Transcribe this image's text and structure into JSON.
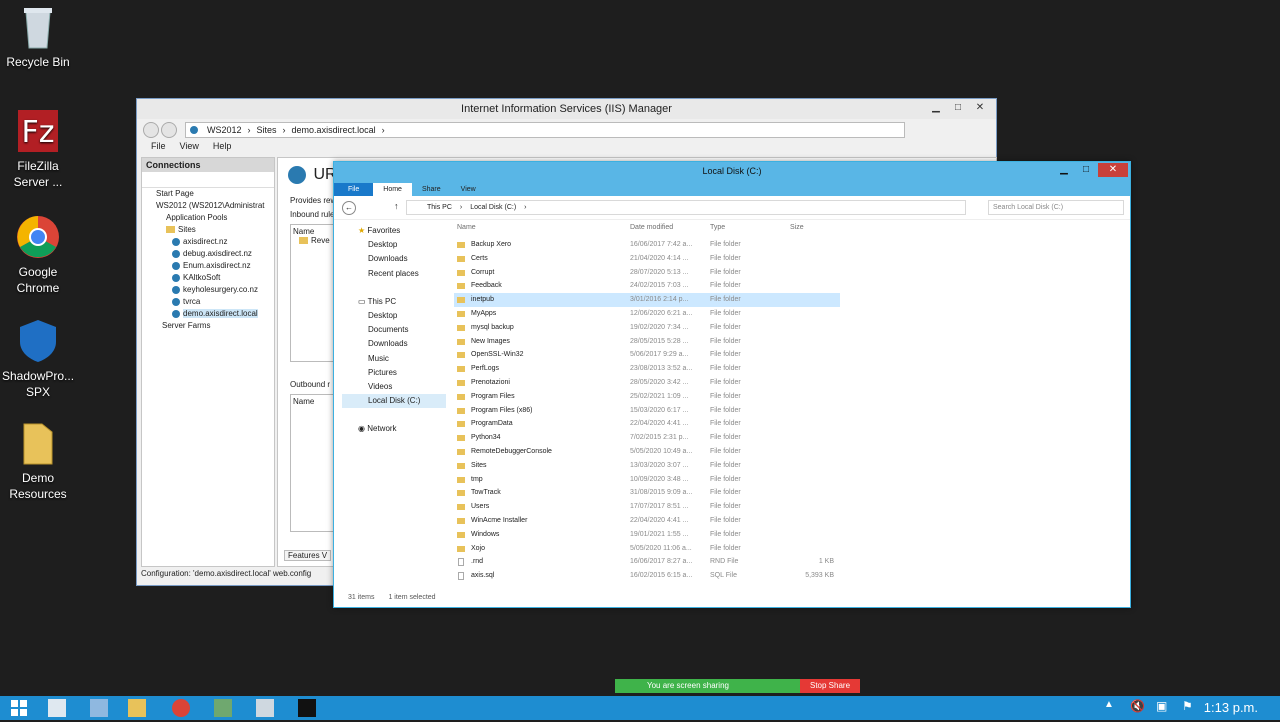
{
  "desktop": {
    "icons": [
      {
        "label": "Recycle Bin",
        "icon": "recycle-bin-icon"
      },
      {
        "label": "FileZilla Server ...",
        "icon": "filezilla-icon"
      },
      {
        "label": "Google Chrome",
        "icon": "chrome-icon"
      },
      {
        "label": "ShadowPro... SPX",
        "icon": "shield-icon"
      },
      {
        "label": "Demo Resources",
        "icon": "folder-icon"
      }
    ]
  },
  "iis": {
    "title": "Internet Information Services (IIS) Manager",
    "breadcrumb": [
      "WS2012",
      "Sites",
      "demo.axisdirect.local"
    ],
    "menu": [
      "File",
      "View",
      "Help"
    ],
    "connections_header": "Connections",
    "tree": [
      {
        "label": "Start Page",
        "level": 0
      },
      {
        "label": "WS2012 (WS2012\\Administrat",
        "level": 0
      },
      {
        "label": "Application Pools",
        "level": 1
      },
      {
        "label": "Sites",
        "level": 1
      },
      {
        "label": "axisdirect.nz",
        "level": 2
      },
      {
        "label": "debug.axisdirect.nz",
        "level": 2
      },
      {
        "label": "Enum.axisdirect.nz",
        "level": 2
      },
      {
        "label": "KAltkoSoft",
        "level": 2
      },
      {
        "label": "keyholesurgery.co.nz",
        "level": 2
      },
      {
        "label": "tvrca",
        "level": 2
      },
      {
        "label": "demo.axisdirect.local",
        "level": 2
      },
      {
        "label": "Server Farms",
        "level": 1
      }
    ],
    "main": {
      "heading": "UR",
      "provides": "Provides rew",
      "inbound": "Inbound rule",
      "col_name": "Name",
      "reve": "Reve",
      "outbound": "Outbound r",
      "col_name2": "Name",
      "features_tab": "Features V"
    },
    "status": "Configuration: 'demo.axisdirect.local' web.config"
  },
  "explorer": {
    "title": "Local Disk (C:)",
    "ribbon_tabs": [
      "File",
      "Home",
      "Share",
      "View"
    ],
    "path": [
      "This PC",
      "Local Disk (C:)"
    ],
    "search_placeholder": "Search Local Disk (C:)",
    "nav": {
      "favorites": "Favorites",
      "fav_items": [
        "Desktop",
        "Downloads",
        "Recent places"
      ],
      "this_pc": "This PC",
      "pc_items": [
        "Desktop",
        "Documents",
        "Downloads",
        "Music",
        "Pictures",
        "Videos",
        "Local Disk (C:)"
      ],
      "network": "Network"
    },
    "columns": {
      "name": "Name",
      "date": "Date modified",
      "type": "Type",
      "size": "Size"
    },
    "files": [
      {
        "name": "Backup Xero",
        "date": "16/06/2017 7:42 a...",
        "type": "File folder",
        "size": ""
      },
      {
        "name": "Certs",
        "date": "21/04/2020 4:14 ...",
        "type": "File folder",
        "size": ""
      },
      {
        "name": "Corrupt",
        "date": "28/07/2020 5:13 ...",
        "type": "File folder",
        "size": ""
      },
      {
        "name": "Feedback",
        "date": "24/02/2015 7:03 ...",
        "type": "File folder",
        "size": ""
      },
      {
        "name": "inetpub",
        "date": "3/01/2016 2:14 p...",
        "type": "File folder",
        "size": ""
      },
      {
        "name": "MyApps",
        "date": "12/06/2020 6:21 a...",
        "type": "File folder",
        "size": ""
      },
      {
        "name": "mysql backup",
        "date": "19/02/2020 7:34 ...",
        "type": "File folder",
        "size": ""
      },
      {
        "name": "New Images",
        "date": "28/05/2015 5:28 ...",
        "type": "File folder",
        "size": ""
      },
      {
        "name": "OpenSSL-Win32",
        "date": "5/06/2017 9:29 a...",
        "type": "File folder",
        "size": ""
      },
      {
        "name": "PerfLogs",
        "date": "23/08/2013 3:52 a...",
        "type": "File folder",
        "size": ""
      },
      {
        "name": "Prenotazioni",
        "date": "28/05/2020 3:42 ...",
        "type": "File folder",
        "size": ""
      },
      {
        "name": "Program Files",
        "date": "25/02/2021 1:09 ...",
        "type": "File folder",
        "size": ""
      },
      {
        "name": "Program Files (x86)",
        "date": "15/03/2020 6:17 ...",
        "type": "File folder",
        "size": ""
      },
      {
        "name": "ProgramData",
        "date": "22/04/2020 4:41 ...",
        "type": "File folder",
        "size": ""
      },
      {
        "name": "Python34",
        "date": "7/02/2015 2:31 p...",
        "type": "File folder",
        "size": ""
      },
      {
        "name": "RemoteDebuggerConsole",
        "date": "5/05/2020 10:49 a...",
        "type": "File folder",
        "size": ""
      },
      {
        "name": "Sites",
        "date": "13/03/2020 3:07 ...",
        "type": "File folder",
        "size": ""
      },
      {
        "name": "tmp",
        "date": "10/09/2020 3:48 ...",
        "type": "File folder",
        "size": ""
      },
      {
        "name": "TowTrack",
        "date": "31/08/2015 9:09 a...",
        "type": "File folder",
        "size": ""
      },
      {
        "name": "Users",
        "date": "17/07/2017 8:51 ...",
        "type": "File folder",
        "size": ""
      },
      {
        "name": "WinAcme Installer",
        "date": "22/04/2020 4:41 ...",
        "type": "File folder",
        "size": ""
      },
      {
        "name": "Windows",
        "date": "19/01/2021 1:55 ...",
        "type": "File folder",
        "size": ""
      },
      {
        "name": "Xojo",
        "date": "5/05/2020 11:06 a...",
        "type": "File folder",
        "size": ""
      },
      {
        "name": ".rnd",
        "date": "16/06/2017 8:27 a...",
        "type": "RND File",
        "size": "1 KB"
      },
      {
        "name": "axis.sql",
        "date": "16/02/2015 6:15 a...",
        "type": "SQL File",
        "size": "5,393 KB"
      }
    ],
    "selected_index": 4,
    "status_items": "31 items",
    "status_selected": "1 item selected"
  },
  "share_bar": {
    "text": "You are screen sharing",
    "stop": "Stop Share"
  },
  "taskbar": {
    "clock": "1:13 p.m."
  }
}
